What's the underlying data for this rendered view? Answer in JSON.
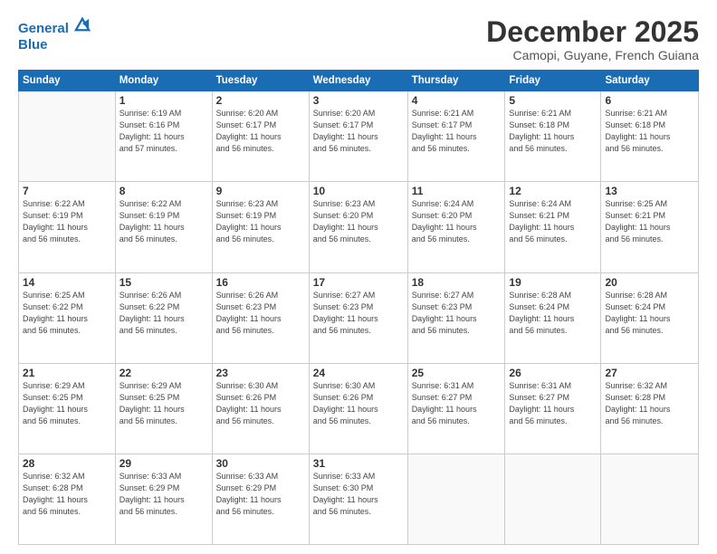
{
  "logo": {
    "line1": "General",
    "line2": "Blue"
  },
  "title": "December 2025",
  "subtitle": "Camopi, Guyane, French Guiana",
  "header_days": [
    "Sunday",
    "Monday",
    "Tuesday",
    "Wednesday",
    "Thursday",
    "Friday",
    "Saturday"
  ],
  "weeks": [
    [
      {
        "day": "",
        "info": ""
      },
      {
        "day": "1",
        "info": "Sunrise: 6:19 AM\nSunset: 6:16 PM\nDaylight: 11 hours\nand 57 minutes."
      },
      {
        "day": "2",
        "info": "Sunrise: 6:20 AM\nSunset: 6:17 PM\nDaylight: 11 hours\nand 56 minutes."
      },
      {
        "day": "3",
        "info": "Sunrise: 6:20 AM\nSunset: 6:17 PM\nDaylight: 11 hours\nand 56 minutes."
      },
      {
        "day": "4",
        "info": "Sunrise: 6:21 AM\nSunset: 6:17 PM\nDaylight: 11 hours\nand 56 minutes."
      },
      {
        "day": "5",
        "info": "Sunrise: 6:21 AM\nSunset: 6:18 PM\nDaylight: 11 hours\nand 56 minutes."
      },
      {
        "day": "6",
        "info": "Sunrise: 6:21 AM\nSunset: 6:18 PM\nDaylight: 11 hours\nand 56 minutes."
      }
    ],
    [
      {
        "day": "7",
        "info": "Sunrise: 6:22 AM\nSunset: 6:19 PM\nDaylight: 11 hours\nand 56 minutes."
      },
      {
        "day": "8",
        "info": "Sunrise: 6:22 AM\nSunset: 6:19 PM\nDaylight: 11 hours\nand 56 minutes."
      },
      {
        "day": "9",
        "info": "Sunrise: 6:23 AM\nSunset: 6:19 PM\nDaylight: 11 hours\nand 56 minutes."
      },
      {
        "day": "10",
        "info": "Sunrise: 6:23 AM\nSunset: 6:20 PM\nDaylight: 11 hours\nand 56 minutes."
      },
      {
        "day": "11",
        "info": "Sunrise: 6:24 AM\nSunset: 6:20 PM\nDaylight: 11 hours\nand 56 minutes."
      },
      {
        "day": "12",
        "info": "Sunrise: 6:24 AM\nSunset: 6:21 PM\nDaylight: 11 hours\nand 56 minutes."
      },
      {
        "day": "13",
        "info": "Sunrise: 6:25 AM\nSunset: 6:21 PM\nDaylight: 11 hours\nand 56 minutes."
      }
    ],
    [
      {
        "day": "14",
        "info": "Sunrise: 6:25 AM\nSunset: 6:22 PM\nDaylight: 11 hours\nand 56 minutes."
      },
      {
        "day": "15",
        "info": "Sunrise: 6:26 AM\nSunset: 6:22 PM\nDaylight: 11 hours\nand 56 minutes."
      },
      {
        "day": "16",
        "info": "Sunrise: 6:26 AM\nSunset: 6:23 PM\nDaylight: 11 hours\nand 56 minutes."
      },
      {
        "day": "17",
        "info": "Sunrise: 6:27 AM\nSunset: 6:23 PM\nDaylight: 11 hours\nand 56 minutes."
      },
      {
        "day": "18",
        "info": "Sunrise: 6:27 AM\nSunset: 6:23 PM\nDaylight: 11 hours\nand 56 minutes."
      },
      {
        "day": "19",
        "info": "Sunrise: 6:28 AM\nSunset: 6:24 PM\nDaylight: 11 hours\nand 56 minutes."
      },
      {
        "day": "20",
        "info": "Sunrise: 6:28 AM\nSunset: 6:24 PM\nDaylight: 11 hours\nand 56 minutes."
      }
    ],
    [
      {
        "day": "21",
        "info": "Sunrise: 6:29 AM\nSunset: 6:25 PM\nDaylight: 11 hours\nand 56 minutes."
      },
      {
        "day": "22",
        "info": "Sunrise: 6:29 AM\nSunset: 6:25 PM\nDaylight: 11 hours\nand 56 minutes."
      },
      {
        "day": "23",
        "info": "Sunrise: 6:30 AM\nSunset: 6:26 PM\nDaylight: 11 hours\nand 56 minutes."
      },
      {
        "day": "24",
        "info": "Sunrise: 6:30 AM\nSunset: 6:26 PM\nDaylight: 11 hours\nand 56 minutes."
      },
      {
        "day": "25",
        "info": "Sunrise: 6:31 AM\nSunset: 6:27 PM\nDaylight: 11 hours\nand 56 minutes."
      },
      {
        "day": "26",
        "info": "Sunrise: 6:31 AM\nSunset: 6:27 PM\nDaylight: 11 hours\nand 56 minutes."
      },
      {
        "day": "27",
        "info": "Sunrise: 6:32 AM\nSunset: 6:28 PM\nDaylight: 11 hours\nand 56 minutes."
      }
    ],
    [
      {
        "day": "28",
        "info": "Sunrise: 6:32 AM\nSunset: 6:28 PM\nDaylight: 11 hours\nand 56 minutes."
      },
      {
        "day": "29",
        "info": "Sunrise: 6:33 AM\nSunset: 6:29 PM\nDaylight: 11 hours\nand 56 minutes."
      },
      {
        "day": "30",
        "info": "Sunrise: 6:33 AM\nSunset: 6:29 PM\nDaylight: 11 hours\nand 56 minutes."
      },
      {
        "day": "31",
        "info": "Sunrise: 6:33 AM\nSunset: 6:30 PM\nDaylight: 11 hours\nand 56 minutes."
      },
      {
        "day": "",
        "info": ""
      },
      {
        "day": "",
        "info": ""
      },
      {
        "day": "",
        "info": ""
      }
    ]
  ]
}
